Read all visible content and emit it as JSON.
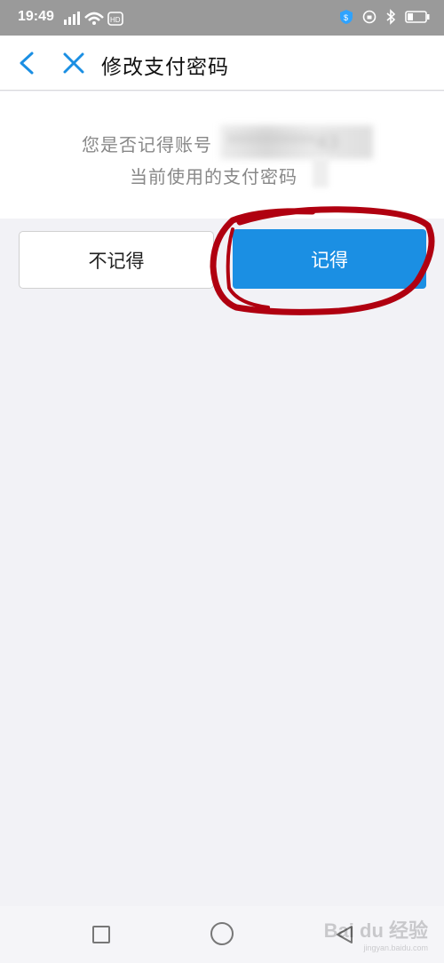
{
  "status_bar": {
    "time": "19:49",
    "network_label": "4G",
    "hd_label": "HD"
  },
  "header": {
    "title": "修改支付密码"
  },
  "prompt": {
    "line1": "您是否记得账号",
    "line2": "当前使用的支付密码",
    "account_masked": "**********43"
  },
  "buttons": {
    "forget_label": "不记得",
    "remember_label": "记得"
  },
  "colors": {
    "accent": "#1b8fe3",
    "annotation": "#b00010",
    "icon_blue": "#1b8fe3"
  },
  "watermark": {
    "brand": "Bai du 经验",
    "url": "jingyan.baidu.com"
  }
}
